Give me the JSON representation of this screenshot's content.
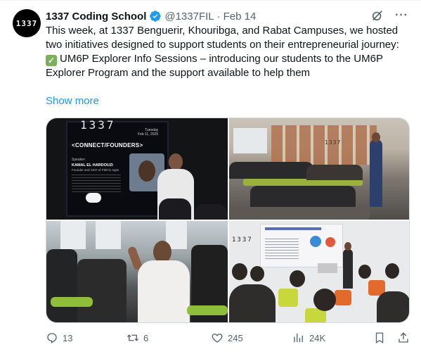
{
  "author": {
    "avatar_text": "1337",
    "name": "1337 Coding School",
    "handle": "@1337FIL",
    "separator": "·",
    "date": "Feb 14"
  },
  "text": {
    "line1": "This week, at 1337 Benguerir, Khouribga, and Rabat Campuses, we hosted two initiatives designed to support students on their entrepreneurial journey:",
    "line2": "UM6P Explorer Info Sessions – introducing our students to the UM6P Explorer Program and the support available to help them",
    "show_more": "Show more"
  },
  "media": {
    "photo1": {
      "brand": "1337",
      "day": "Tuesday",
      "date": "Feb 11, 2025",
      "title": "<CONNECT/FOUNDERS>",
      "speaker_label": "Speaker:",
      "speaker_name": "KAMAL EL HARDOUZI",
      "speaker_role": "Founder and CEO of FMCG Apps",
      "badge": "fmcg"
    },
    "photo2": {
      "brand": "1337"
    },
    "photo4": {
      "brand": "1337"
    }
  },
  "actions": {
    "replies": "13",
    "reposts": "6",
    "likes": "245",
    "views": "24K"
  },
  "colors": {
    "accent": "#1d9bf0",
    "muted": "#536471",
    "text": "#0f1419",
    "verified": "#1d9bf0"
  }
}
